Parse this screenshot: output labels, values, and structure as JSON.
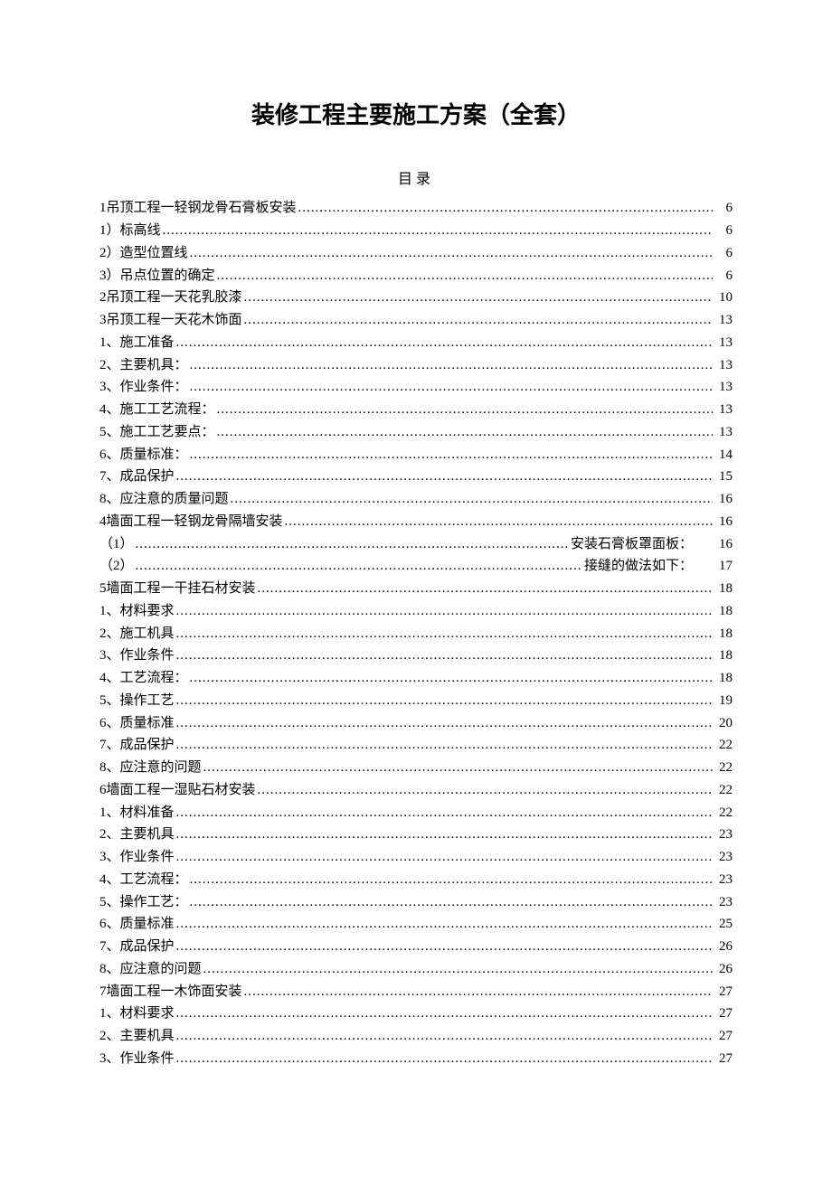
{
  "title": "装修工程主要施工方案（全套）",
  "toc_label": "目录",
  "toc": [
    {
      "label": "1吊顶工程一轻钢龙骨石膏板安装",
      "page": "6"
    },
    {
      "label": "1）标高线",
      "page": "6"
    },
    {
      "label": "2）造型位置线",
      "page": "6"
    },
    {
      "label": "3）吊点位置的确定",
      "page": "6"
    },
    {
      "label": "2吊顶工程一天花乳胶漆",
      "page": "10"
    },
    {
      "label": "3吊顶工程一天花木饰面",
      "page": "13"
    },
    {
      "label": "1、施工准备",
      "page": "13"
    },
    {
      "label": "2、主要机具：",
      "page": "13"
    },
    {
      "label": "3、作业条件：",
      "page": "13"
    },
    {
      "label": "4、施工工艺流程：",
      "page": "13"
    },
    {
      "label": "5、施工工艺要点：",
      "page": "13"
    },
    {
      "label": "6、质量标准：",
      "page": "14"
    },
    {
      "label": "7、成品保护",
      "page": "15"
    },
    {
      "label": "8、应注意的质量问题",
      "page": "16"
    },
    {
      "label": "4墙面工程一轻钢龙骨隔墙安装",
      "page": "16"
    },
    {
      "label": "（1）",
      "trail": "安装石膏板罩面板：",
      "page": "16",
      "wide": true
    },
    {
      "label": "（2）",
      "trail": "接缝的做法如下：",
      "page": "17",
      "wide": true
    },
    {
      "label": "5墙面工程一干挂石材安装",
      "page": "18"
    },
    {
      "label": "1、材料要求",
      "page": "18"
    },
    {
      "label": "2、施工机具",
      "page": "18"
    },
    {
      "label": "3、作业条件",
      "page": "18"
    },
    {
      "label": "4、工艺流程：",
      "page": "18"
    },
    {
      "label": "5、操作工艺",
      "page": "19"
    },
    {
      "label": "6、质量标准",
      "page": "20"
    },
    {
      "label": "7、成品保护",
      "page": "22"
    },
    {
      "label": "8、应注意的问题",
      "page": "22"
    },
    {
      "label": "6墙面工程一湿贴石材安装",
      "page": "22"
    },
    {
      "label": "1、材料准备",
      "page": "22"
    },
    {
      "label": "2、主要机具",
      "page": "23"
    },
    {
      "label": "3、作业条件",
      "page": "23"
    },
    {
      "label": "4、工艺流程：",
      "page": "23"
    },
    {
      "label": "5、操作工艺：",
      "page": "23"
    },
    {
      "label": "6、质量标准",
      "page": "25"
    },
    {
      "label": "7、成品保护",
      "page": "26"
    },
    {
      "label": "8、应注意的问题",
      "page": "26"
    },
    {
      "label": "7墙面工程一木饰面安装",
      "page": "27"
    },
    {
      "label": "1、材料要求",
      "page": "27"
    },
    {
      "label": "2、主要机具",
      "page": "27"
    },
    {
      "label": "3、作业条件",
      "page": "27"
    }
  ]
}
